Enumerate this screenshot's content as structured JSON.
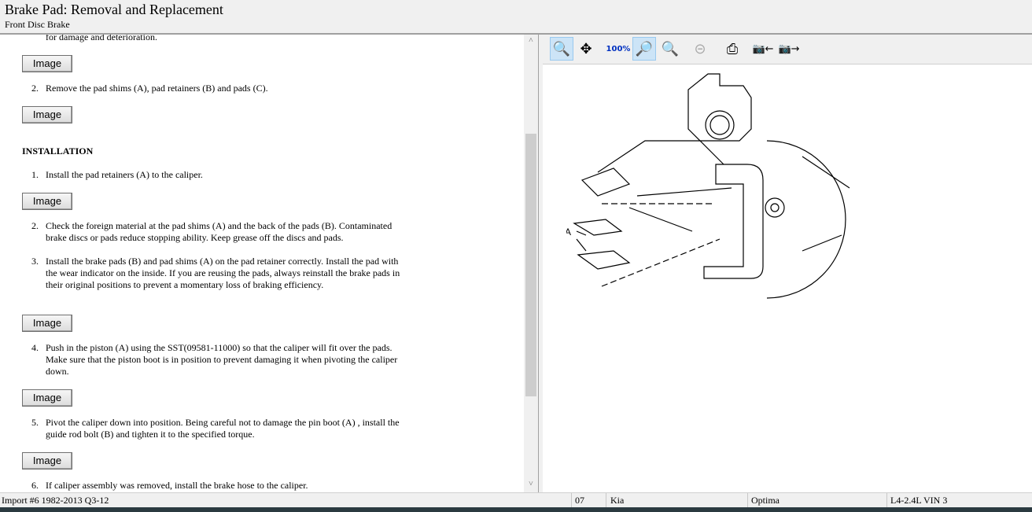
{
  "header": {
    "title": "Brake Pad:  Removal and Replacement",
    "subtitle": "Front Disc Brake"
  },
  "content": {
    "partial_line": "for damage and deterioration.",
    "image_label": "Image",
    "removal_steps": [
      {
        "n": "2.",
        "text": "Remove the pad shims (A), pad retainers (B) and pads (C)."
      }
    ],
    "installation_heading": "INSTALLATION",
    "install_steps": [
      {
        "n": "1.",
        "text": "Install the pad retainers (A) to the caliper."
      },
      {
        "n": "2.",
        "text": "Check the foreign material at the pad shims (A) and the back of the pads (B). Contaminated brake discs or pads reduce stopping ability. Keep grease off the discs and pads."
      },
      {
        "n": "3.",
        "text": "Install the brake pads (B) and pad shims (A) on the pad retainer correctly. Install the pad with the wear indicator on the inside. If you are reusing the pads, always reinstall the brake pads in their original positions to prevent a momentary loss of braking efficiency."
      },
      {
        "n": "4.",
        "text": "Push in the piston (A) using the SST(09581-11000) so that the caliper will fit over the pads. Make sure that the piston boot is in position to prevent damaging it when pivoting the caliper down."
      },
      {
        "n": "5.",
        "text": "Pivot the caliper down into position. Being careful not to damage the pin boot (A) , install the guide rod bolt (B) and tighten it to the specified torque."
      },
      {
        "n": "6.",
        "text": "If caliper assembly was removed, install the brake hose to the caliper."
      }
    ]
  },
  "toolbar": [
    "zoom-in-icon",
    "pan-icon",
    "zoom-100-icon",
    "zoom-fit-icon",
    "zoom-width-icon",
    "zoom-out-icon",
    "print-icon",
    "previous-image-icon",
    "next-image-icon"
  ],
  "diagram": {
    "label": "A"
  },
  "status": {
    "source": "Import #6 1982-2013 Q3-12",
    "year": "07",
    "make": "Kia",
    "model": "Optima",
    "engine": "L4-2.4L VIN 3"
  }
}
